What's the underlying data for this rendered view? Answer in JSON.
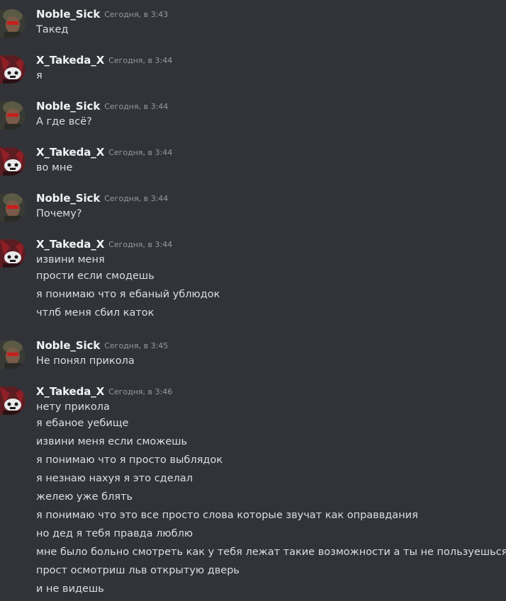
{
  "messages": [
    {
      "author": "Noble_Sick",
      "avatar": "noble-sick-avatar",
      "time": "Сегодня, в 3:43",
      "lines": [
        "Такед"
      ]
    },
    {
      "author": "X_Takeda_X",
      "avatar": "x-takeda-avatar",
      "time": "Сегодня, в 3:44",
      "lines": [
        "я"
      ]
    },
    {
      "author": "Noble_Sick",
      "avatar": "noble-sick-avatar",
      "time": "Сегодня, в 3:44",
      "lines": [
        "А где всё?"
      ]
    },
    {
      "author": "X_Takeda_X",
      "avatar": "x-takeda-avatar",
      "time": "Сегодня, в 3:44",
      "lines": [
        "во мне"
      ]
    },
    {
      "author": "Noble_Sick",
      "avatar": "noble-sick-avatar",
      "time": "Сегодня, в 3:44",
      "lines": [
        "Почему?"
      ]
    },
    {
      "author": "X_Takeda_X",
      "avatar": "x-takeda-avatar",
      "time": "Сегодня, в 3:44",
      "lines": [
        "извини меня",
        "прости если смодешь",
        "я понимаю что я ебаный ублюдок",
        "чтлб меня сбил каток"
      ]
    },
    {
      "author": "Noble_Sick",
      "avatar": "noble-sick-avatar",
      "time": "Сегодня, в 3:45",
      "lines": [
        "Не понял прикола"
      ]
    },
    {
      "author": "X_Takeda_X",
      "avatar": "x-takeda-avatar",
      "time": "Сегодня, в 3:46",
      "lines": [
        "нету прикола",
        "я ебаное уебище",
        "извини меня если сможешь",
        "я понимаю что я просто выблядок",
        "я незнаю нахуя я это сделал",
        "желею уже блять",
        "я понимаю что это все просто слова которые звучат как оправвдания",
        "но дед я тебя правда люблю",
        "мне было больно смотреть как у тебя лежат такие возможности а ты не пользуешься",
        "прост осмотриш льв открытую дверь",
        "и не видешь"
      ]
    }
  ]
}
